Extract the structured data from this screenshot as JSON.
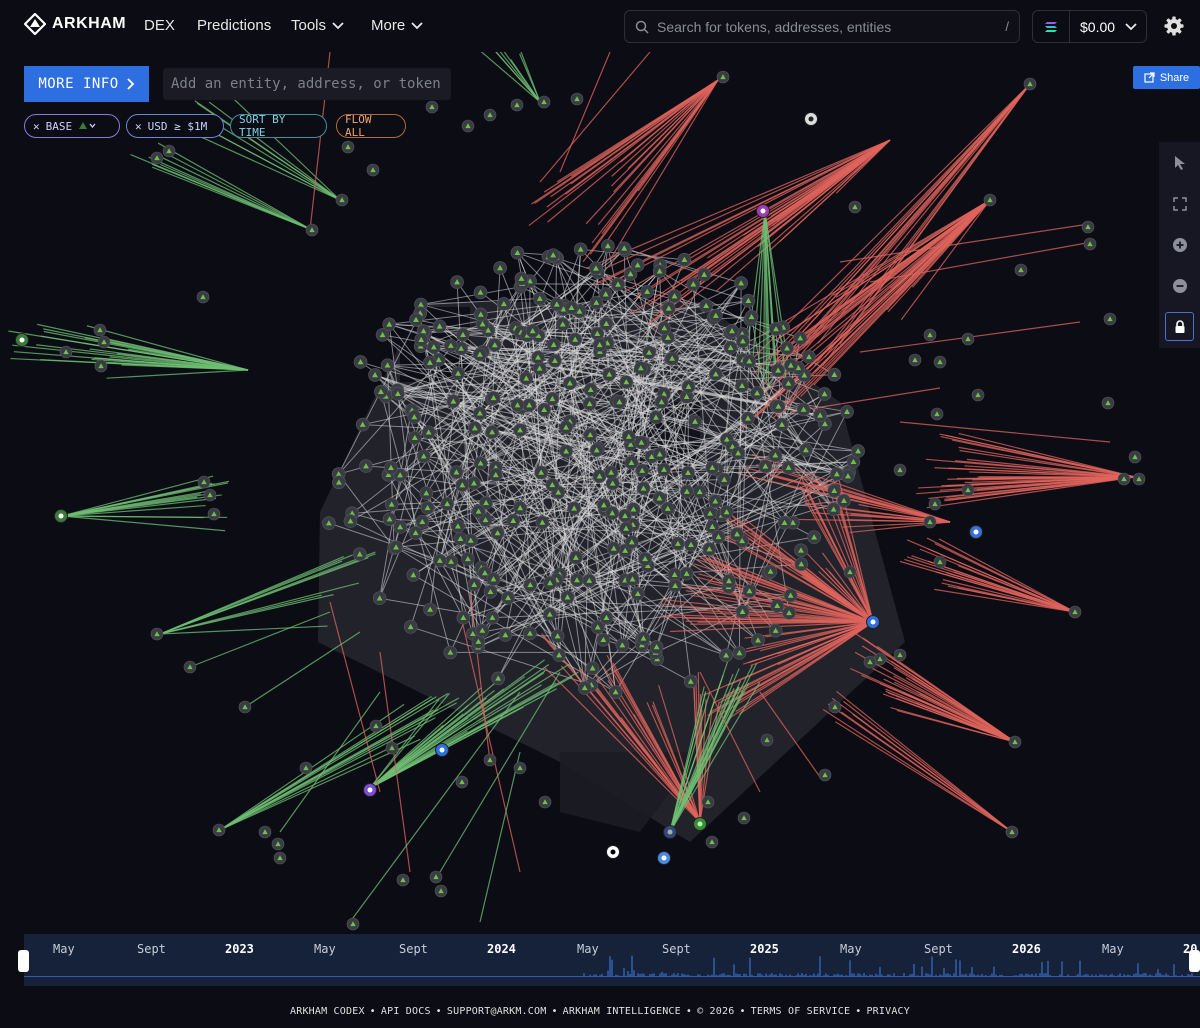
{
  "nav": {
    "brand": "ARKHAM",
    "items": [
      {
        "label": "DEX",
        "dropdown": false
      },
      {
        "label": "Predictions",
        "dropdown": false
      },
      {
        "label": "Tools",
        "dropdown": true
      },
      {
        "label": "More",
        "dropdown": true
      }
    ],
    "search_placeholder": "Search for tokens, addresses, entities",
    "search_shortcut": "/",
    "balance": "$0.00"
  },
  "panel": {
    "more_info_label": "MORE INFO",
    "add_placeholder": "Add an entity, address, or token",
    "share_label": "Share"
  },
  "filters": [
    {
      "label": "BASE",
      "removable": true
    },
    {
      "label": "USD ≥ $1M",
      "removable": true
    },
    {
      "label": "SORT BY TIME",
      "removable": false
    },
    {
      "label": "FLOW ALL",
      "removable": false
    }
  ],
  "toolbar": [
    "pointer-icon",
    "fit-view-icon",
    "zoom-in-icon",
    "zoom-out-icon",
    "lock-icon"
  ],
  "timeline": {
    "labels": [
      "May",
      "Sept",
      "2023",
      "May",
      "Sept",
      "2024",
      "May",
      "Sept",
      "2025",
      "May",
      "Sept",
      "2026",
      "May",
      "20"
    ],
    "years": [
      "2023",
      "2024",
      "2025",
      "2026",
      "20"
    ]
  },
  "colors": {
    "inflow": "#6fbf73",
    "outflow": "#e0645c",
    "internal": "#d9d9d9",
    "accent": "#2d6fe0",
    "node": "#3a3c44"
  },
  "footer": [
    "ARKHAM CODEX",
    "API DOCS",
    "SUPPORT@ARKM.COM",
    "ARKHAM INTELLIGENCE",
    "© 2026",
    "TERMS OF SERVICE",
    "PRIVACY"
  ]
}
